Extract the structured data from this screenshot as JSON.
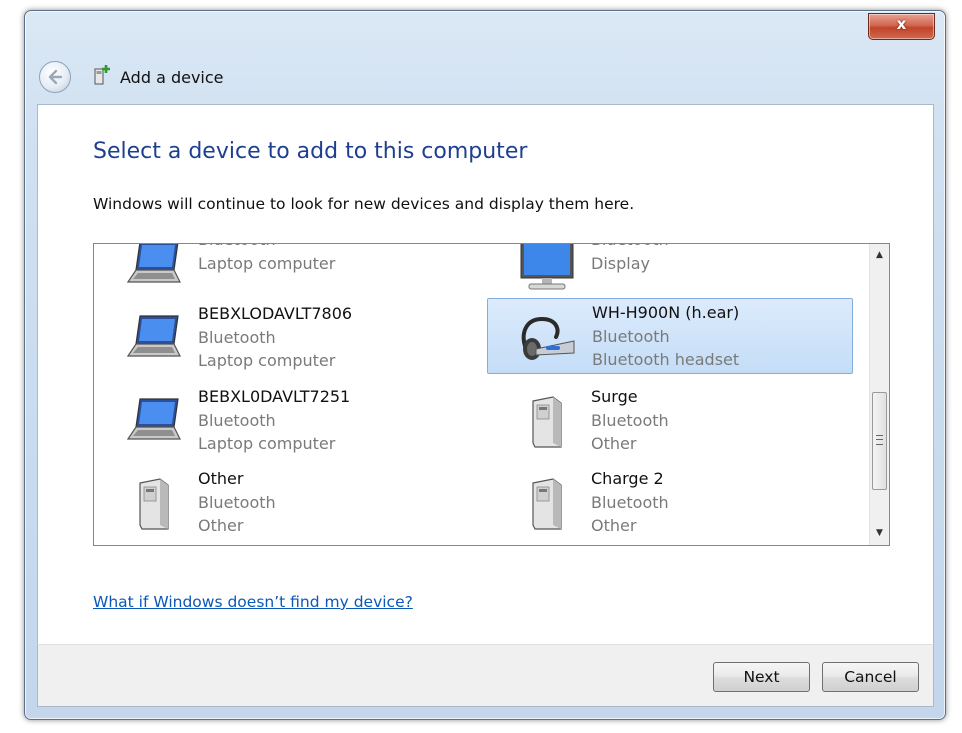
{
  "window": {
    "title": "Add a device",
    "close_label": "x"
  },
  "content": {
    "heading": "Select a device to add to this computer",
    "subtext": "Windows will continue to look for new devices and display them here.",
    "help_link": "What if Windows doesn’t find my device?"
  },
  "devices": [
    {
      "name": "",
      "connection": "Bluetooth",
      "type": "Laptop computer",
      "icon": "laptop-icon"
    },
    {
      "name": "",
      "connection": "Bluetooth",
      "type": "Display",
      "icon": "monitor-icon"
    },
    {
      "name": "BEBXLODAVLT7806",
      "connection": "Bluetooth",
      "type": "Laptop computer",
      "icon": "laptop-icon"
    },
    {
      "name": "WH-H900N (h.ear)",
      "connection": "Bluetooth",
      "type": "Bluetooth headset",
      "icon": "headset-icon",
      "selected": true
    },
    {
      "name": "BEBXL0DAVLT7251",
      "connection": "Bluetooth",
      "type": "Laptop computer",
      "icon": "laptop-icon"
    },
    {
      "name": "Surge",
      "connection": "Bluetooth",
      "type": "Other",
      "icon": "generic-device-icon"
    },
    {
      "name": "Other",
      "connection": "Bluetooth",
      "type": "Other",
      "icon": "generic-device-icon"
    },
    {
      "name": "Charge 2",
      "connection": "Bluetooth",
      "type": "Other",
      "icon": "generic-device-icon"
    }
  ],
  "buttons": {
    "next": "Next",
    "cancel": "Cancel"
  },
  "colors": {
    "heading": "#1e3f8f",
    "link": "#0b58b8",
    "selection": "#c4ddf7"
  }
}
